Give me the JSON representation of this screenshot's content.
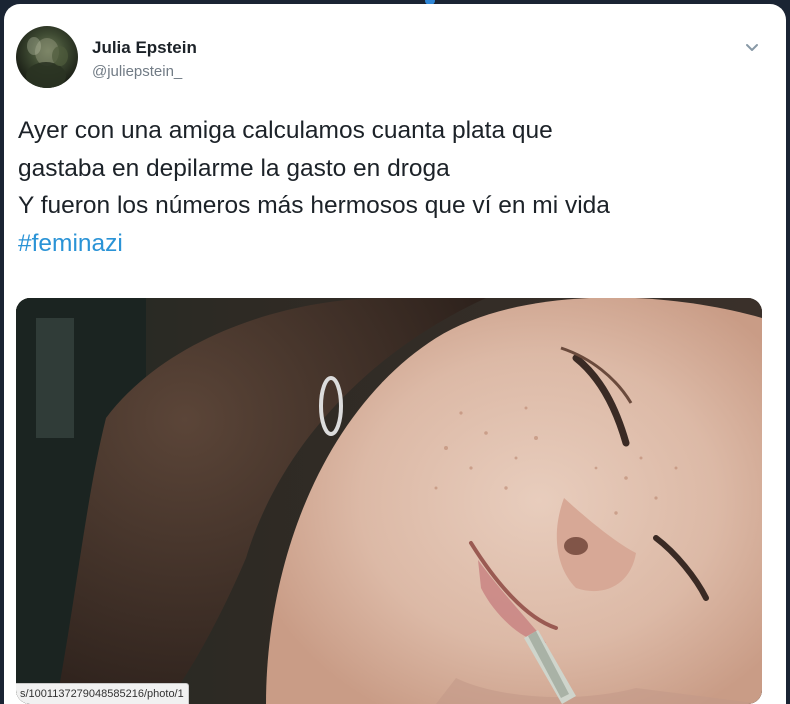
{
  "tweet": {
    "author": {
      "display_name": "Julia Epstein",
      "handle": "@juliepstein_"
    },
    "menu_icon": "chevron-down-icon",
    "text_lines": [
      "Ayer con una amiga calculamos cuanta plata que",
      "gastaba en depilarme la gasto en droga",
      "Y fueron los números más hermosos que ví en mi vida"
    ],
    "hashtag": "#feminazi",
    "media": {
      "url_text": "s/1001137279048585216/photo/1"
    }
  },
  "colors": {
    "background": "#1a2433",
    "card": "#ffffff",
    "text": "#1c2228",
    "secondary": "#717b85",
    "link": "#2a93d6"
  }
}
